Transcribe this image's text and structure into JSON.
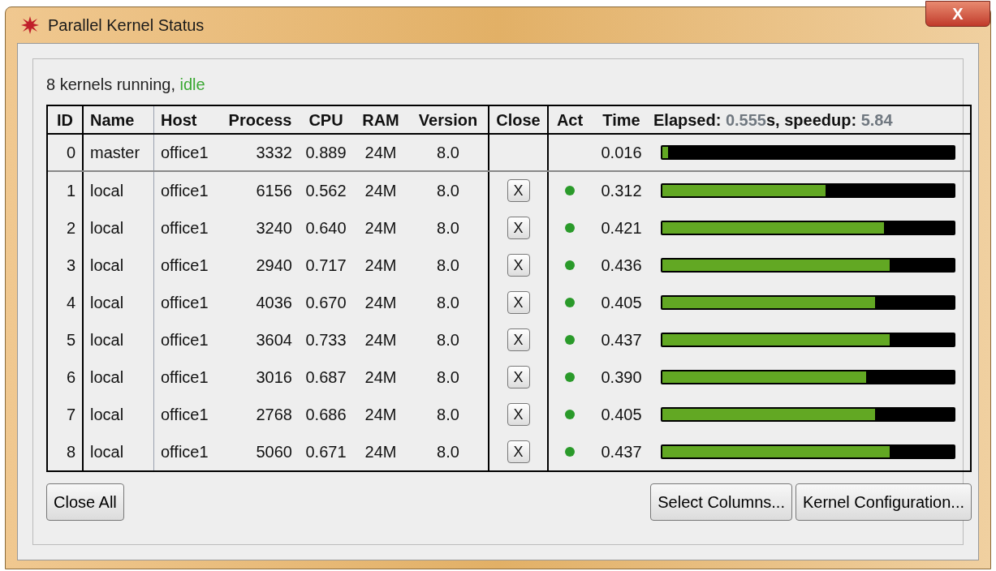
{
  "window": {
    "title": "Parallel Kernel Status",
    "close_glyph": "X"
  },
  "status": {
    "text": "8 kernels running, ",
    "state": "idle"
  },
  "table": {
    "columns": [
      "ID",
      "Name",
      "Host",
      "Process",
      "CPU",
      "RAM",
      "Version",
      "Close",
      "Act",
      "Time"
    ],
    "summary": [
      {
        "kind": "label",
        "text": "Elapsed: "
      },
      {
        "kind": "value",
        "text": "0.555"
      },
      {
        "kind": "label",
        "text": "s, speedup: "
      },
      {
        "kind": "value",
        "text": "5.84"
      }
    ],
    "rows": [
      {
        "id": "0",
        "name": "master",
        "host": "office1",
        "process": "3332",
        "cpu": "0.889",
        "ram": "24M",
        "version": "8.0",
        "closable": false,
        "active": false,
        "time": "0.016",
        "level": 0.02
      },
      {
        "id": "1",
        "name": "local",
        "host": "office1",
        "process": "6156",
        "cpu": "0.562",
        "ram": "24M",
        "version": "8.0",
        "closable": true,
        "close_label": "X",
        "active": true,
        "time": "0.312",
        "level": 0.56
      },
      {
        "id": "2",
        "name": "local",
        "host": "office1",
        "process": "3240",
        "cpu": "0.640",
        "ram": "24M",
        "version": "8.0",
        "closable": true,
        "close_label": "X",
        "active": true,
        "time": "0.421",
        "level": 0.76
      },
      {
        "id": "3",
        "name": "local",
        "host": "office1",
        "process": "2940",
        "cpu": "0.717",
        "ram": "24M",
        "version": "8.0",
        "closable": true,
        "close_label": "X",
        "active": true,
        "time": "0.436",
        "level": 0.78
      },
      {
        "id": "4",
        "name": "local",
        "host": "office1",
        "process": "4036",
        "cpu": "0.670",
        "ram": "24M",
        "version": "8.0",
        "closable": true,
        "close_label": "X",
        "active": true,
        "time": "0.405",
        "level": 0.73
      },
      {
        "id": "5",
        "name": "local",
        "host": "office1",
        "process": "3604",
        "cpu": "0.733",
        "ram": "24M",
        "version": "8.0",
        "closable": true,
        "close_label": "X",
        "active": true,
        "time": "0.437",
        "level": 0.78
      },
      {
        "id": "6",
        "name": "local",
        "host": "office1",
        "process": "3016",
        "cpu": "0.687",
        "ram": "24M",
        "version": "8.0",
        "closable": true,
        "close_label": "X",
        "active": true,
        "time": "0.390",
        "level": 0.7
      },
      {
        "id": "7",
        "name": "local",
        "host": "office1",
        "process": "2768",
        "cpu": "0.686",
        "ram": "24M",
        "version": "8.0",
        "closable": true,
        "close_label": "X",
        "active": true,
        "time": "0.405",
        "level": 0.73
      },
      {
        "id": "8",
        "name": "local",
        "host": "office1",
        "process": "5060",
        "cpu": "0.671",
        "ram": "24M",
        "version": "8.0",
        "closable": true,
        "close_label": "X",
        "active": true,
        "time": "0.437",
        "level": 0.78
      }
    ]
  },
  "buttons": {
    "left": [
      "Close All"
    ],
    "right": [
      "Select Columns...",
      "Kernel Configuration..."
    ]
  }
}
